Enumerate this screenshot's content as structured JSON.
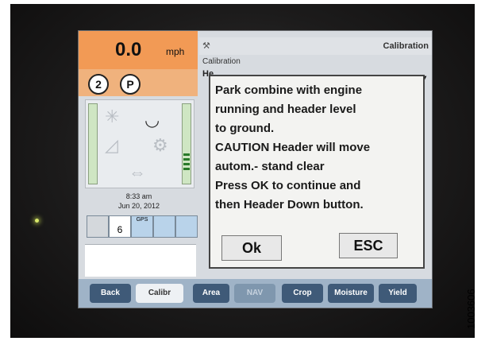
{
  "speed": {
    "value": "0.0",
    "unit": "mph"
  },
  "status": {
    "gear": "2",
    "park": "P"
  },
  "datetime": {
    "time": "8:33 am",
    "date": "Jun 20, 2012"
  },
  "indicators": {
    "gps_label": "GPS",
    "satellites": "6"
  },
  "calibration": {
    "header_title": "Calibration",
    "subtitle": "Calibration",
    "header_fragment": "He",
    "dropdown_arrow": "▼",
    "message_lines": [
      "Park combine with engine",
      "running and header level",
      "to ground.",
      "CAUTION Header will move",
      "autom.- stand clear",
      "Press OK to continue and",
      "then Header Down button."
    ],
    "ok_label": "Ok",
    "esc_label": "ESC"
  },
  "tabs": [
    {
      "label": "Back",
      "style": "dark"
    },
    {
      "label": "Calibr",
      "style": "light"
    },
    {
      "label": "Area",
      "style": "dark"
    },
    {
      "label": "NAV",
      "style": "dim"
    },
    {
      "label": "Crop",
      "style": "dark"
    },
    {
      "label": "Moisture",
      "style": "dark"
    },
    {
      "label": "Yield",
      "style": "dark"
    }
  ],
  "reference_id": "1003606",
  "colors": {
    "speed_bg": "#f29a55",
    "tab_dark": "#3f5a78",
    "screen_bg": "#d7dbe0"
  }
}
